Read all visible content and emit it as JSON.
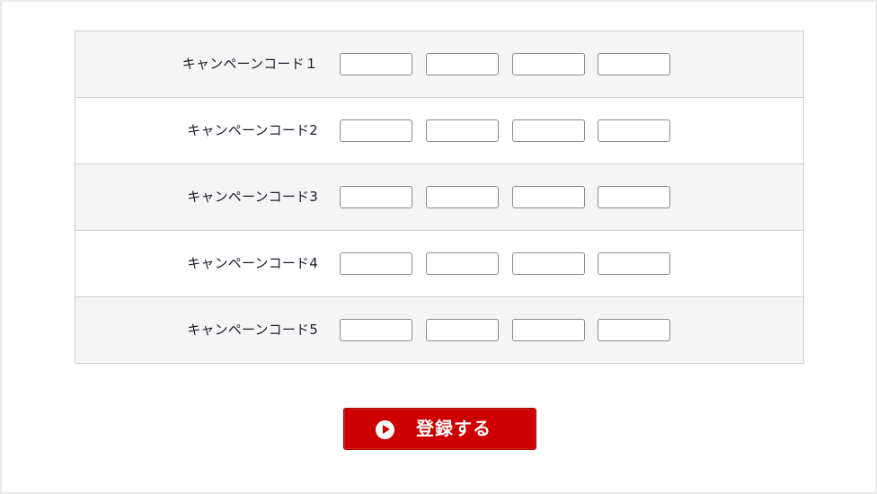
{
  "form": {
    "rows": [
      {
        "label": "キャンペーンコード１",
        "fields": [
          "",
          "",
          "",
          ""
        ]
      },
      {
        "label": "キャンペーンコード2",
        "fields": [
          "",
          "",
          "",
          ""
        ]
      },
      {
        "label": "キャンペーンコード3",
        "fields": [
          "",
          "",
          "",
          ""
        ]
      },
      {
        "label": "キャンペーンコード4",
        "fields": [
          "",
          "",
          "",
          ""
        ]
      },
      {
        "label": "キャンペーンコード5",
        "fields": [
          "",
          "",
          "",
          ""
        ]
      }
    ]
  },
  "submit": {
    "label": "登録する",
    "icon": "play-circle-icon"
  },
  "colors": {
    "accent": "#cc0000",
    "row_shade": "#f5f5f5",
    "border": "#cfcfcf",
    "page_bg": "#ebebeb"
  }
}
